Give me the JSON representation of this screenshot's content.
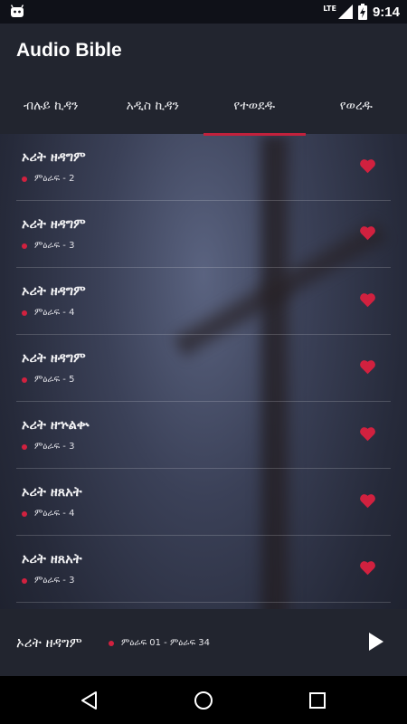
{
  "status_bar": {
    "network": "LTE",
    "time": "9:14"
  },
  "app": {
    "title": "Audio Bible"
  },
  "tabs": [
    {
      "label": "ብሉይ ኪዳን",
      "active": false
    },
    {
      "label": "አዲስ ኪዳን",
      "active": false
    },
    {
      "label": "የተወደዱ",
      "active": true
    },
    {
      "label": "የወረዱ",
      "active": false
    }
  ],
  "favorites": [
    {
      "title": "ኦሪት ዘዳግም",
      "chapter": "ምዕራፍ - 2"
    },
    {
      "title": "ኦሪት ዘዳግም",
      "chapter": "ምዕራፍ - 3"
    },
    {
      "title": "ኦሪት ዘዳግም",
      "chapter": "ምዕራፍ - 4"
    },
    {
      "title": "ኦሪት ዘዳግም",
      "chapter": "ምዕራፍ - 5"
    },
    {
      "title": "ኦሪት ዘኍልቍ",
      "chapter": "ምዕራፍ - 3"
    },
    {
      "title": "ኦሪት ዘጸአት",
      "chapter": "ምዕራፍ - 4"
    },
    {
      "title": "ኦሪት ዘጸአት",
      "chapter": "ምዕራፍ - 3"
    }
  ],
  "player": {
    "title": "ኦሪት ዘዳግም",
    "range": "ምዕራፍ 01 - ምዕራፍ 34"
  },
  "colors": {
    "accent": "#c2213c",
    "heart": "#d1213f",
    "appbar": "#22252f"
  },
  "icons": [
    "android-icon",
    "lte-signal-icon",
    "battery-charging-icon",
    "heart-icon",
    "play-icon",
    "back-icon",
    "home-icon",
    "recents-icon"
  ]
}
